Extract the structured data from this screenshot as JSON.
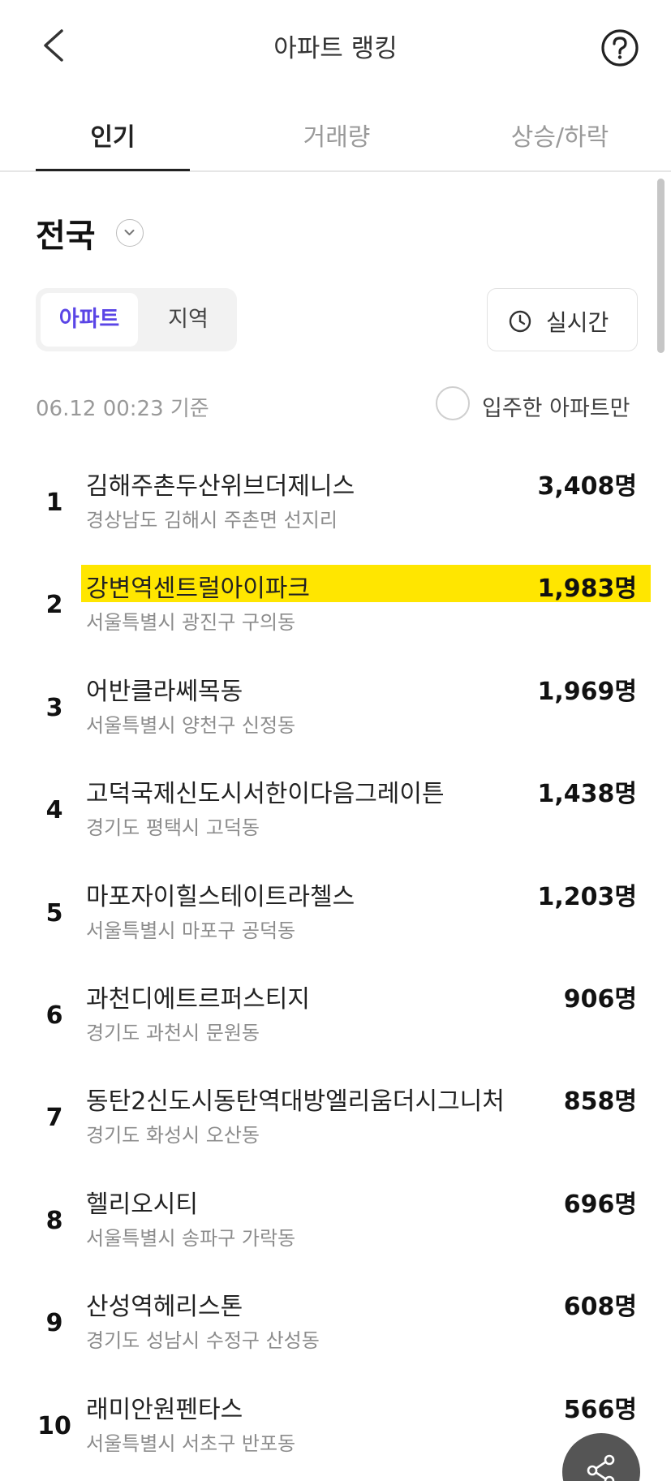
{
  "header": {
    "title": "아파트 랭킹"
  },
  "tabs": [
    {
      "label": "인기",
      "active": true
    },
    {
      "label": "거래량",
      "active": false
    },
    {
      "label": "상승/하락",
      "active": false
    }
  ],
  "region": {
    "label": "전국"
  },
  "segment": {
    "active": "아파트",
    "inactive": "지역"
  },
  "realtime": {
    "label": "실시간"
  },
  "filter": {
    "timestamp": "06.12 00:23 기준",
    "checkbox_label": "입주한 아파트만",
    "checked": false
  },
  "rankings": [
    {
      "rank": "1",
      "name": "김해주촌두산위브더제니스",
      "address": "경상남도 김해시 주촌면 선지리",
      "count": "3,408명",
      "highlighted": false
    },
    {
      "rank": "2",
      "name": "강변역센트럴아이파크",
      "address": "서울특별시 광진구 구의동",
      "count": "1,983명",
      "highlighted": true
    },
    {
      "rank": "3",
      "name": "어반클라쎄목동",
      "address": "서울특별시 양천구 신정동",
      "count": "1,969명",
      "highlighted": false
    },
    {
      "rank": "4",
      "name": "고덕국제신도시서한이다음그레이튼",
      "address": "경기도 평택시 고덕동",
      "count": "1,438명",
      "highlighted": false
    },
    {
      "rank": "5",
      "name": "마포자이힐스테이트라첼스",
      "address": "서울특별시 마포구 공덕동",
      "count": "1,203명",
      "highlighted": false
    },
    {
      "rank": "6",
      "name": "과천디에트르퍼스티지",
      "address": "경기도 과천시 문원동",
      "count": "906명",
      "highlighted": false
    },
    {
      "rank": "7",
      "name": "동탄2신도시동탄역대방엘리움더시그니처",
      "address": "경기도 화성시 오산동",
      "count": "858명",
      "highlighted": false
    },
    {
      "rank": "8",
      "name": "헬리오시티",
      "address": "서울특별시 송파구 가락동",
      "count": "696명",
      "highlighted": false
    },
    {
      "rank": "9",
      "name": "산성역헤리스톤",
      "address": "경기도 성남시 수정구 산성동",
      "count": "608명",
      "highlighted": false
    },
    {
      "rank": "10",
      "name": "래미안원펜타스",
      "address": "서울특별시 서초구 반포동",
      "count": "566명",
      "highlighted": false
    }
  ],
  "icons": {
    "back": "chevron-left-icon",
    "help": "question-circle-icon",
    "region_toggle": "chevron-down-icon",
    "realtime": "clock-icon",
    "share": "share-icon"
  },
  "colors": {
    "accent": "#5a45e6",
    "highlight": "#ffe600",
    "fab": "#555555"
  }
}
